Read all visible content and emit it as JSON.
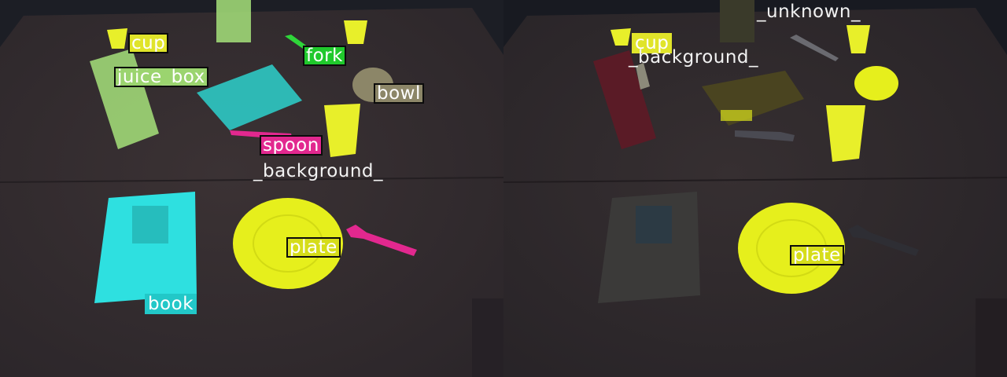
{
  "left_panel": {
    "labels": {
      "cup": "cup",
      "fork": "fork",
      "juice_box": "juice_box",
      "bowl": "bowl",
      "spoon": "spoon",
      "background": "_background_",
      "plate": "plate",
      "book": "book"
    }
  },
  "right_panel": {
    "labels": {
      "unknown": "_unknown_",
      "cup": "cup",
      "background": "_background_",
      "plate": "plate"
    }
  },
  "colors": {
    "cup": "#e8ef2a",
    "fork": "#2fd63a",
    "juice_box": "#a6e27a",
    "bowl": "#8c8668",
    "spoon": "#e2288f",
    "plate": "#e6ef1c",
    "book": "#2ee0e0",
    "table": "#3a3133",
    "background_label": "#f2f2f2"
  }
}
